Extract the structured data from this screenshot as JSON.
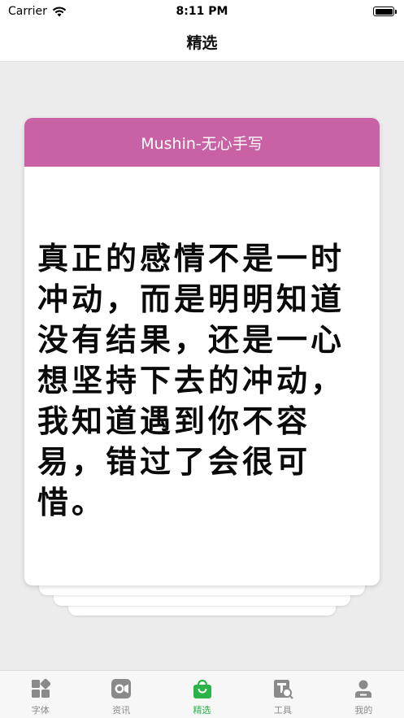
{
  "status_bar": {
    "carrier": "Carrier",
    "time": "8:11 PM"
  },
  "nav": {
    "title": "精选"
  },
  "card": {
    "header": "Mushin-无心手写",
    "text": "真正的感情不是一时冲动，而是明明知道没有结果，还是一心想坚持下去的冲动，我知道遇到你不容易，错过了会很可惜。",
    "header_color": "#c962a4"
  },
  "tabs": [
    {
      "label": "字体",
      "icon": "font-grid-icon",
      "active": false
    },
    {
      "label": "资讯",
      "icon": "news-camera-icon",
      "active": false
    },
    {
      "label": "精选",
      "icon": "shopping-bag-icon",
      "active": true
    },
    {
      "label": "工具",
      "icon": "tool-search-icon",
      "active": false
    },
    {
      "label": "我的",
      "icon": "profile-icon",
      "active": false
    }
  ],
  "colors": {
    "active_tab": "#2bb34a",
    "inactive_tab": "#8a8a8a"
  }
}
